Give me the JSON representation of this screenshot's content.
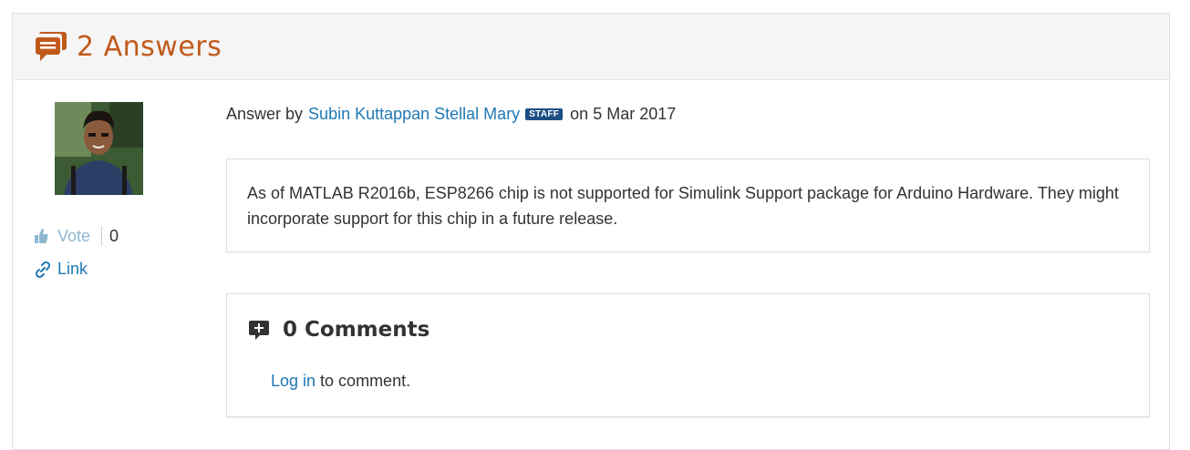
{
  "header": {
    "title": "2 Answers",
    "icon": "answers-icon",
    "color": "#c05a1b"
  },
  "answer": {
    "prefix": "Answer by",
    "author": "Subin Kuttappan Stellal Mary",
    "badge": "STAFF",
    "date_text": "on 5 Mar 2017",
    "body": "As of MATLAB R2016b, ESP8266 chip is not supported for Simulink Support package for Arduino Hardware. They might incorporate support for this chip in a future release."
  },
  "sidebar": {
    "vote_label": "Vote",
    "vote_count": "0",
    "link_label": "Link"
  },
  "comments": {
    "title": "0 Comments",
    "login_link": "Log in",
    "login_suffix": " to comment."
  },
  "colors": {
    "link": "#1f78b4",
    "badge": "#1d4f85"
  }
}
